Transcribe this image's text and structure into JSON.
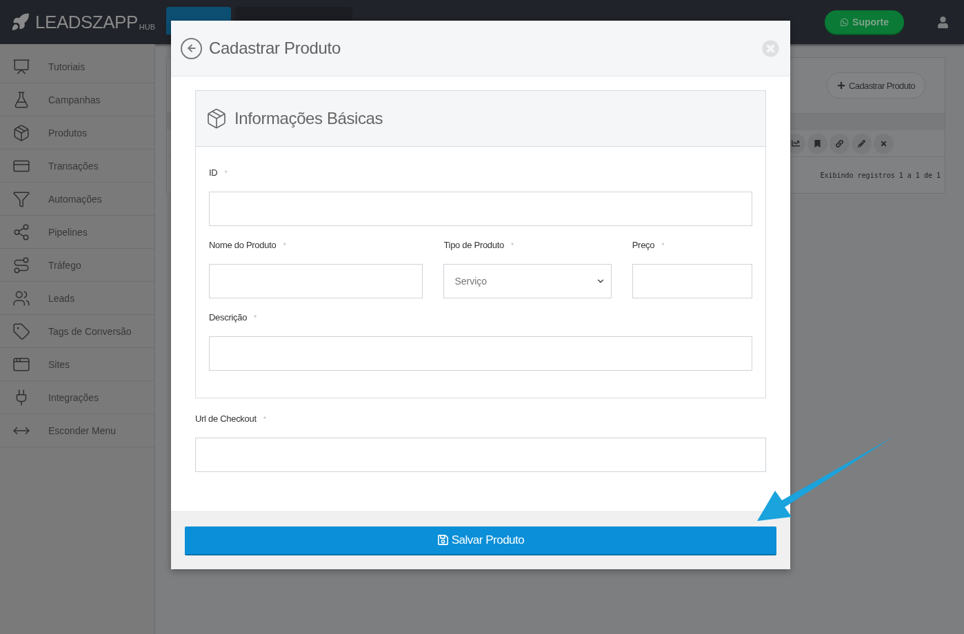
{
  "topbar": {
    "logo": "LEADSZAPP",
    "logo_suffix": "HUB",
    "support_button": "Suporte"
  },
  "sidebar": {
    "items": [
      {
        "label": "Tutoriais"
      },
      {
        "label": "Campanhas"
      },
      {
        "label": "Produtos"
      },
      {
        "label": "Transações"
      },
      {
        "label": "Automações"
      },
      {
        "label": "Pipelines"
      },
      {
        "label": "Tráfego"
      },
      {
        "label": "Leads"
      },
      {
        "label": "Tags de Conversão"
      },
      {
        "label": "Sites"
      },
      {
        "label": "Integrações"
      },
      {
        "label": "Esconder Menu"
      }
    ]
  },
  "background_panel": {
    "add_button": "Cadastrar Produto",
    "records_info": "Exibindo registros 1 a 1 de 1"
  },
  "modal": {
    "title": "Cadastrar Produto",
    "section": {
      "title": "Informações Básicas",
      "rows": [
        [
          {
            "label": "ID",
            "marker": "*",
            "kind": "text"
          }
        ],
        [
          {
            "label": "Nome do Produto",
            "marker": "*",
            "kind": "text"
          },
          {
            "label": "Tipo de Produto",
            "marker": "*",
            "kind": "select",
            "value": "Serviço"
          },
          {
            "label": "Preço",
            "marker": "*",
            "kind": "text"
          }
        ],
        [
          {
            "label": "Descrição",
            "marker": "*",
            "kind": "text"
          }
        ]
      ]
    },
    "checkout_field": {
      "label": "Url de Checkout",
      "marker": "*",
      "kind": "text"
    },
    "save_button": "Salvar Produto"
  }
}
